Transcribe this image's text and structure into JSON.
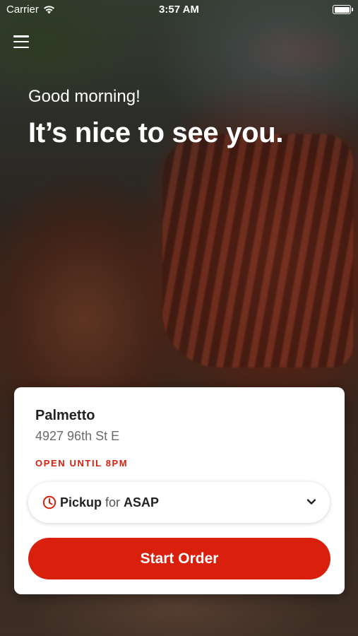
{
  "status_bar": {
    "carrier": "Carrier",
    "time": "3:57 AM",
    "wifi_icon": "wifi-icon",
    "battery_icon": "battery-icon"
  },
  "header": {
    "menu_icon": "hamburger-menu-icon"
  },
  "greeting": {
    "salutation": "Good morning!",
    "headline": "It’s nice to see you."
  },
  "store_card": {
    "name": "Palmetto",
    "address": "4927 96th St E",
    "hours": "OPEN UNTIL 8PM",
    "order_mode": {
      "mode": "Pickup",
      "connector": "for",
      "time": "ASAP",
      "clock_icon": "clock-icon",
      "chevron_icon": "chevron-down-icon"
    },
    "start_order_label": "Start Order"
  },
  "colors": {
    "accent": "#d9200c",
    "hours_text": "#d8200d",
    "card_background": "#ffffff"
  }
}
